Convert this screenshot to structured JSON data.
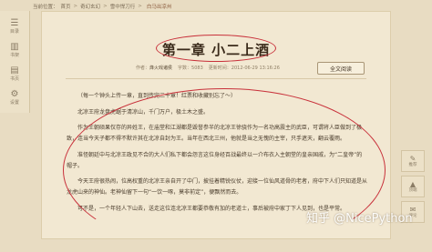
{
  "breadcrumb": {
    "label": "当前位置：",
    "items": [
      "首页",
      "奇幻玄幻",
      "雪中悍刀行"
    ],
    "separator": ">",
    "current": "白马出凉州"
  },
  "sidebar": {
    "items": [
      {
        "icon": "list-icon",
        "glyph": "☰",
        "label": "目录"
      },
      {
        "icon": "bookshelf-icon",
        "glyph": "▥",
        "label": "书架"
      },
      {
        "icon": "book-icon",
        "glyph": "▤",
        "label": "书页"
      },
      {
        "icon": "gear-icon",
        "glyph": "⚙",
        "label": "设置"
      }
    ]
  },
  "chapter": {
    "title": "第一章 小二上酒",
    "meta": {
      "author_label": "作者：",
      "author": "烽火戏诸侯",
      "words_label": "字数：",
      "words": "5083",
      "updated_label": "更新时间：",
      "updated": "2012-06-29 13:16:26"
    },
    "fullread_button": "全文阅读",
    "paragraphs": [
      "（每一个钟头上传一章，直到传完二十章！红票和收藏别忘了～）",
      "北凉王府龙盘虎踞于清凉山，千门万户，极土木之盛。",
      "作为王朝硕果仅存的异姓王，在庙堂和江湖都是毁誉参半的北凉王徐骁作为一名功高震主的武臣，可谓将人臣做到了极致，连当今天子都不得不默许其在北凉自封为王。当年在西北三州，他就是当之无愧的主宰，只手遮天，翻云覆雨。",
      "准怪朝廷中与北凉王政见不合的大人们私下都会怨言这位身经百战最终以一介布衣入主朝堂的皇亲国戚，为“二皇帝”的帽子。",
      "今天王府很热闹，位高权重的北凉王亲自开了中门，披挂着精锐仪仗，迎接一位仙风道骨的老者，府中下人们只知道是从龙虎山来的神仙。老神仙留下一句“一饮一啄，莫非前定”，便飘然而去。",
      "可不是，一个年轻人下山去，送走这位连北凉王都要恭敬有加的老道士，事后被府中家丁下人见到，也是平常。"
    ]
  },
  "rightbar": {
    "items": [
      {
        "icon": "tip-icon",
        "glyph": "✎",
        "label": "推荐"
      },
      {
        "icon": "top-icon",
        "glyph": "▲",
        "label": "顶端"
      },
      {
        "icon": "comment-icon",
        "glyph": "✉",
        "label": "评论"
      }
    ]
  },
  "watermark": "知乎 @NicePython",
  "colors": {
    "annotation": "#c8303a",
    "paper": "#f2e8d2",
    "background": "#e8dcc2"
  }
}
